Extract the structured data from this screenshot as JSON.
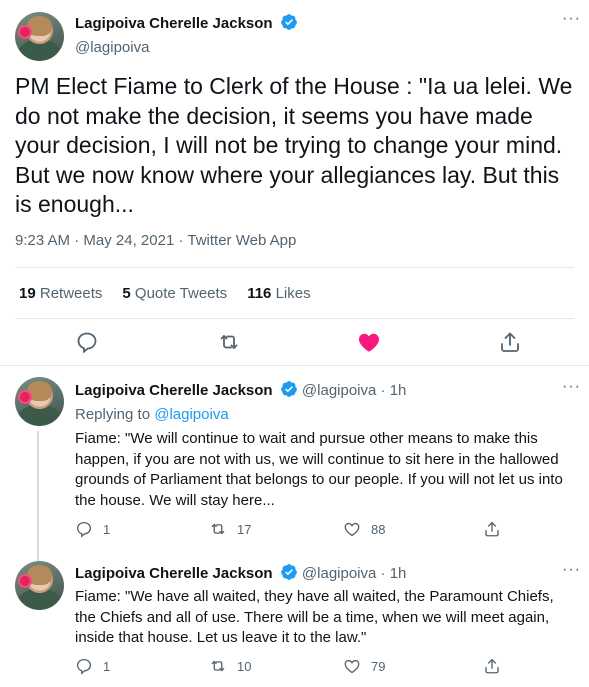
{
  "main": {
    "author_name": "Lagipoiva Cherelle Jackson",
    "author_handle": "@lagipoiva",
    "text": "PM Elect Fiame to Clerk of the House : \"Ia ua lelei. We do not make the decision, it seems you have made your decision, I will not be trying to change your mind. But we now know where your allegiances lay. But this is enough...",
    "time": "9:23 AM",
    "date": "May 24, 2021",
    "source": "Twitter Web App",
    "retweets_count": "19",
    "retweets_label": "Retweets",
    "quotes_count": "5",
    "quotes_label": "Quote Tweets",
    "likes_count": "116",
    "likes_label": "Likes",
    "liked": true
  },
  "replies": [
    {
      "author_name": "Lagipoiva Cherelle Jackson",
      "author_handle": "@lagipoiva",
      "age": "1h",
      "replying_label": "Replying to",
      "replying_handle": "@lagipoiva",
      "text": "Fiame: \"We will continue to wait and pursue other means to make this happen, if you are not with us, we will continue to sit here in the hallowed grounds of Parliament that belongs to our people. If you will not let us into the house. We will stay here...",
      "reply_count": "1",
      "retweet_count": "17",
      "like_count": "88"
    },
    {
      "author_name": "Lagipoiva Cherelle Jackson",
      "author_handle": "@lagipoiva",
      "age": "1h",
      "text": "Fiame: \"We have all waited, they have all waited, the Paramount Chiefs, the Chiefs and all of use. There will be a time, when we will meet again, inside that house. Let us leave it to the law.\"",
      "reply_count": "1",
      "retweet_count": "10",
      "like_count": "79"
    }
  ],
  "separators": {
    "dot": "·",
    "more": "···"
  },
  "icons": {
    "verified": "verified-badge-icon",
    "reply": "reply-icon",
    "retweet": "retweet-icon",
    "like": "heart-icon",
    "share": "share-icon"
  },
  "colors": {
    "accent": "#1d9bf0",
    "like_active": "#f91880",
    "muted": "#536471"
  }
}
